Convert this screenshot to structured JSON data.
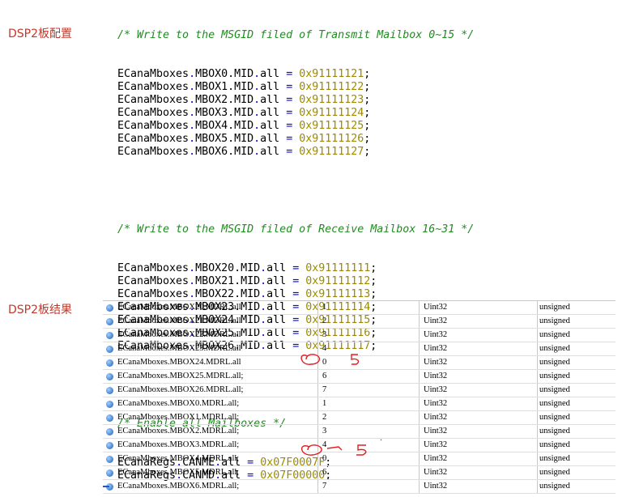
{
  "labels": {
    "config": "DSP2板配置",
    "result": "DSP2板结果"
  },
  "code": {
    "transmit_comment": "/* Write to the MSGID filed of Transmit Mailbox 0~15 */",
    "transmit": [
      {
        "target": "ECanaMboxes",
        "dot": ".",
        "field": "MBOX0.MID",
        "dot2": ".",
        "member": "all",
        "eq": " = ",
        "value": "0x91111121",
        "end": ";"
      },
      {
        "target": "ECanaMboxes",
        "dot": ".",
        "field": "MBOX1.MID",
        "dot2": ".",
        "member": "all",
        "eq": " = ",
        "value": "0x91111122",
        "end": ";"
      },
      {
        "target": "ECanaMboxes",
        "dot": ".",
        "field": "MBOX2.MID",
        "dot2": ".",
        "member": "all",
        "eq": " = ",
        "value": "0x91111123",
        "end": ";"
      },
      {
        "target": "ECanaMboxes",
        "dot": ".",
        "field": "MBOX3.MID",
        "dot2": ".",
        "member": "all",
        "eq": " = ",
        "value": "0x91111124",
        "end": ";"
      },
      {
        "target": "ECanaMboxes",
        "dot": ".",
        "field": "MBOX4.MID",
        "dot2": ".",
        "member": "all",
        "eq": " = ",
        "value": "0x91111125",
        "end": ";"
      },
      {
        "target": "ECanaMboxes",
        "dot": ".",
        "field": "MBOX5.MID",
        "dot2": ".",
        "member": "all",
        "eq": " = ",
        "value": "0x91111126",
        "end": ";"
      },
      {
        "target": "ECanaMboxes",
        "dot": ".",
        "field": "MBOX6.MID",
        "dot2": ".",
        "member": "all",
        "eq": " = ",
        "value": "0x91111127",
        "end": ";"
      }
    ],
    "receive_comment": "/* Write to the MSGID filed of Receive Mailbox 16~31 */",
    "receive": [
      {
        "target": "ECanaMboxes",
        "dot": ".",
        "field": "MBOX20.MID",
        "dot2": ".",
        "member": "all",
        "eq": " = ",
        "value": "0x91111111",
        "end": ";"
      },
      {
        "target": "ECanaMboxes",
        "dot": ".",
        "field": "MBOX21.MID",
        "dot2": ".",
        "member": "all",
        "eq": " = ",
        "value": "0x91111112",
        "end": ";"
      },
      {
        "target": "ECanaMboxes",
        "dot": ".",
        "field": "MBOX22.MID",
        "dot2": ".",
        "member": "all",
        "eq": " = ",
        "value": "0x91111113",
        "end": ";"
      },
      {
        "target": "ECanaMboxes",
        "dot": ".",
        "field": "MBOX23.MID",
        "dot2": ".",
        "member": "all",
        "eq": " = ",
        "value": "0x91111114",
        "end": ";"
      },
      {
        "target": "ECanaMboxes",
        "dot": ".",
        "field": "MBOX24.MID",
        "dot2": ".",
        "member": "all",
        "eq": " = ",
        "value": "0x91111115",
        "end": ";"
      },
      {
        "target": "ECanaMboxes",
        "dot": ".",
        "field": "MBOX25.MID",
        "dot2": ".",
        "member": "all",
        "eq": " = ",
        "value": "0x91111116",
        "end": ";"
      },
      {
        "target": "ECanaMboxes",
        "dot": ".",
        "field": "MBOX26.MID",
        "dot2": ".",
        "member": "all",
        "eq": " = ",
        "value": "0x91111117",
        "end": ";"
      }
    ],
    "enable_comment": "/* Enable all Mailboxes */",
    "enable": [
      {
        "target": "ECanaRegs",
        "dot": ".",
        "field": "CANME",
        "dot2": ".",
        "member": "all",
        "eq": " = ",
        "value": "0x07F0007F",
        "end": ";"
      },
      {
        "target": "ECanaRegs",
        "dot": ".",
        "field": "CANMD",
        "dot2": ".",
        "member": "all",
        "eq": " = ",
        "value": "0x07F00000",
        "end": ";"
      }
    ]
  },
  "watch": {
    "rows": [
      {
        "name": "ECanaMboxes.MBOX20.MDRL.all",
        "value": "1",
        "type": "Uint32",
        "format": "unsigned"
      },
      {
        "name": "ECanaMboxes.MBOX21.MDRL.all",
        "value": "2",
        "type": "Uint32",
        "format": "unsigned"
      },
      {
        "name": "ECanaMboxes.MBOX22.MDRL.all",
        "value": "3",
        "type": "Uint32",
        "format": "unsigned"
      },
      {
        "name": "ECanaMboxes.MBOX23.MDRL.all",
        "value": "4",
        "type": "Uint32",
        "format": "unsigned"
      },
      {
        "name": "ECanaMboxes.MBOX24.MDRL.all",
        "value": "0",
        "type": "Uint32",
        "format": "unsigned"
      },
      {
        "name": "ECanaMboxes.MBOX25.MDRL.all;",
        "value": "6",
        "type": "Uint32",
        "format": "unsigned"
      },
      {
        "name": "ECanaMboxes.MBOX26.MDRL.all;",
        "value": "7",
        "type": "Uint32",
        "format": "unsigned"
      },
      {
        "name": "ECanaMboxes.MBOX0.MDRL.all;",
        "value": "1",
        "type": "Uint32",
        "format": "unsigned"
      },
      {
        "name": "ECanaMboxes.MBOX1.MDRL.all;",
        "value": "2",
        "type": "Uint32",
        "format": "unsigned"
      },
      {
        "name": "ECanaMboxes.MBOX2.MDRL.all;",
        "value": "3",
        "type": "Uint32",
        "format": "unsigned"
      },
      {
        "name": "ECanaMboxes.MBOX3.MDRL.all;",
        "value": "4",
        "type": "Uint32",
        "format": "unsigned"
      },
      {
        "name": "ECanaMboxes.MBOX4.MDRL.all;",
        "value": "0",
        "type": "Uint32",
        "format": "unsigned"
      },
      {
        "name": "ECanaMboxes.MBOX5.MDRL.all;",
        "value": "6",
        "type": "Uint32",
        "format": "unsigned"
      },
      {
        "name": "ECanaMboxes.MBOX6.MDRL.all;",
        "value": "7",
        "type": "Uint32",
        "format": "unsigned"
      }
    ],
    "row_icon": "watch-variable-icon"
  },
  "annotations": {
    "color": "#e02020",
    "handwritten_note": "5"
  }
}
